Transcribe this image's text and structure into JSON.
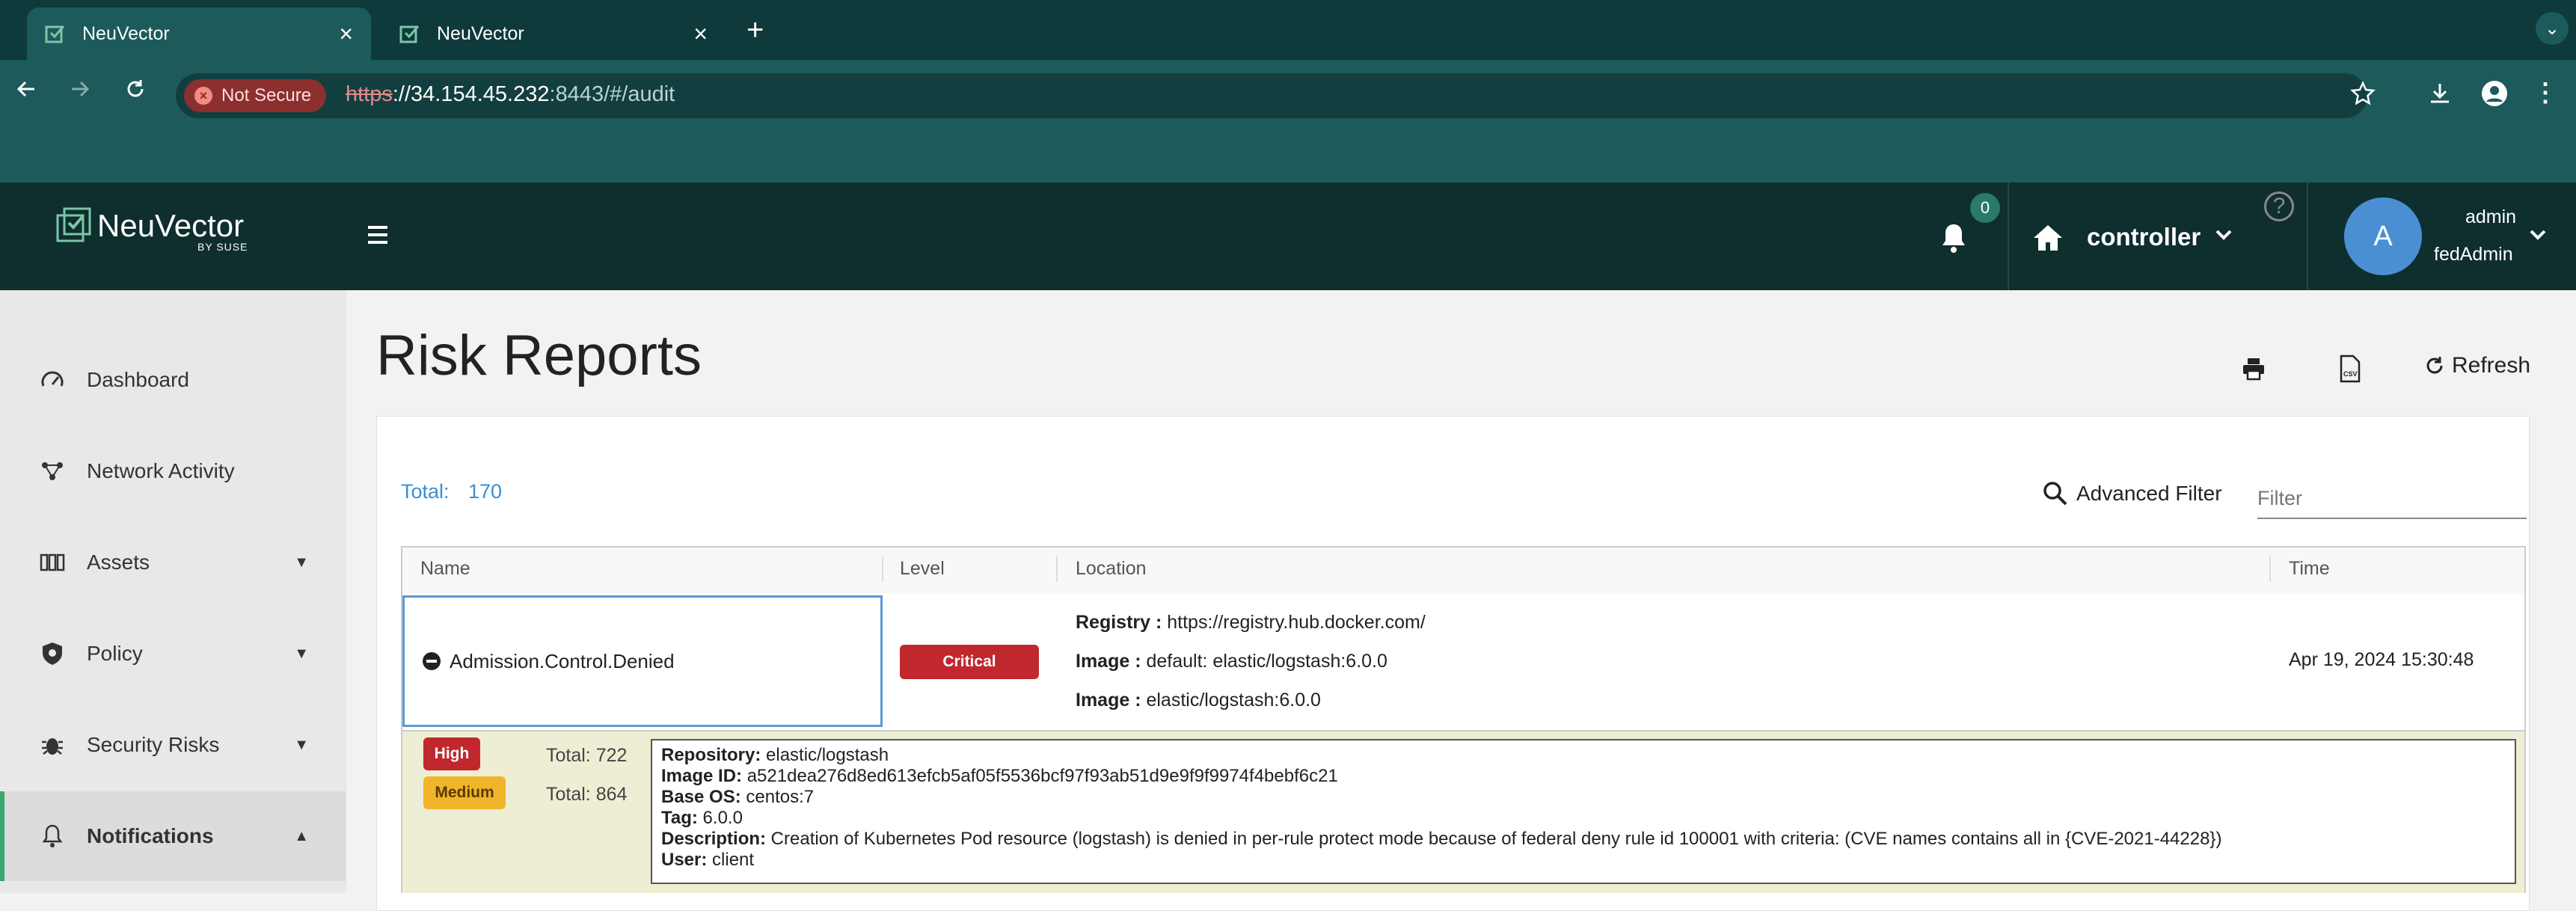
{
  "browser": {
    "tabs": [
      {
        "title": "NeuVector",
        "active": true
      },
      {
        "title": "NeuVector",
        "active": false
      }
    ],
    "security_label": "Not Secure",
    "url": {
      "scheme": "https",
      "host": "://34.154.45.232",
      "rest": ":8443/#/audit"
    }
  },
  "header": {
    "brand": "NeuVector",
    "brand_sub": "BY SUSE",
    "notification_count": "0",
    "cluster": "controller",
    "help": "?",
    "avatar_initial": "A",
    "username": "admin",
    "role": "fedAdmin"
  },
  "sidebar": {
    "items": [
      {
        "label": "Dashboard",
        "icon": "gauge-icon"
      },
      {
        "label": "Network Activity",
        "icon": "network-icon"
      },
      {
        "label": "Assets",
        "icon": "assets-icon",
        "expandable": true
      },
      {
        "label": "Policy",
        "icon": "shield-icon",
        "expandable": true
      },
      {
        "label": "Security Risks",
        "icon": "bug-icon",
        "expandable": true
      },
      {
        "label": "Notifications",
        "icon": "bell-icon",
        "expandable": true,
        "active": true
      }
    ]
  },
  "page": {
    "title": "Risk Reports",
    "refresh_label": "Refresh",
    "total_label": "Total:",
    "total_value": "170",
    "advanced_filter_label": "Advanced Filter",
    "filter_placeholder": "Filter"
  },
  "table": {
    "columns": [
      "Name",
      "Level",
      "Location",
      "Time"
    ],
    "row": {
      "name": "Admission.Control.Denied",
      "level": "Critical",
      "location": [
        {
          "key": "Registry :",
          "value": " https://registry.hub.docker.com/"
        },
        {
          "key": "Image :",
          "value": " default: elastic/logstash:6.0.0"
        },
        {
          "key": "Image :",
          "value": " elastic/logstash:6.0.0"
        }
      ],
      "time": "Apr 19, 2024 15:30:48"
    },
    "detail": {
      "high_label": "High",
      "high_total": "Total: 722",
      "medium_label": "Medium",
      "medium_total": "Total: 864",
      "fields": [
        {
          "key": "Repository:",
          "value": " elastic/logstash"
        },
        {
          "key": "Image ID:",
          "value": " a521dea276d8ed613efcb5af05f5536bcf97f93ab51d9e9f9f9974f4bebf6c21"
        },
        {
          "key": "Base OS:",
          "value": " centos:7"
        },
        {
          "key": "Tag:",
          "value": " 6.0.0"
        },
        {
          "key": "Description:",
          "value": " Creation of Kubernetes Pod resource (logstash) is denied in per-rule protect mode because of federal deny rule id 100001 with criteria: (CVE names contains all in {CVE-2021-44228})"
        },
        {
          "key": "User:",
          "value": " client"
        }
      ]
    }
  },
  "colors": {
    "chrome_dark": "#0e3a3c",
    "chrome": "#1c5a5c",
    "app_header": "#0f2e2e",
    "critical": "#c0282e",
    "medium": "#f0b52a",
    "accent_blue": "#3a8fd4",
    "active_green": "#3aa870"
  }
}
